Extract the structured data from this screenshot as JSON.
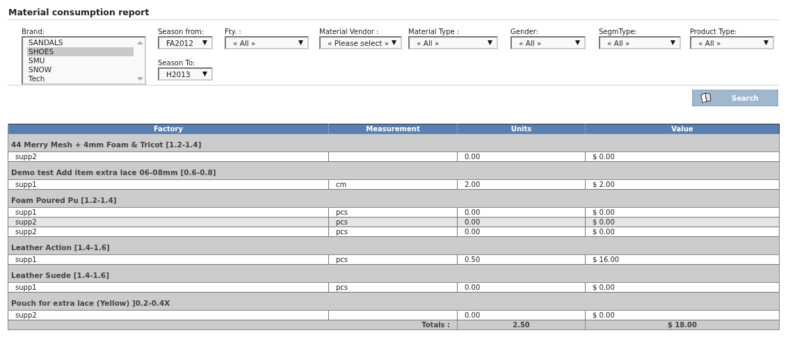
{
  "title": "Material consumption report",
  "filters": {
    "brand": {
      "label": "Brand:",
      "items": [
        {
          "label": "SANDALS",
          "selected": false
        },
        {
          "label": "SHOES",
          "selected": true
        },
        {
          "label": "SMU",
          "selected": false
        },
        {
          "label": "SNOW",
          "selected": false
        },
        {
          "label": "Tech",
          "selected": false
        }
      ]
    },
    "season_from": {
      "label": "Season from:",
      "value": "FA2012"
    },
    "season_to": {
      "label": "Season To:",
      "value": "H2013"
    },
    "selects": [
      {
        "label": "Fty. :",
        "value": "« All »"
      },
      {
        "label": "Material Vendor :",
        "value": "« Please select »"
      },
      {
        "label": "Material Type :",
        "value": "« All »"
      },
      {
        "label": "Gender:",
        "value": "« All »"
      },
      {
        "label": "SegmType:",
        "value": "« All »"
      },
      {
        "label": "Product Type:",
        "value": "« All »"
      }
    ]
  },
  "search_button": {
    "label": "Search",
    "disabled": true
  },
  "table": {
    "columns": [
      "Factory",
      "Measurement",
      "Units",
      "Value"
    ],
    "groups": [
      {
        "name": "44 Merry Mesh + 4mm Foam & Tricot [1.2-1.4]",
        "rows": [
          {
            "cells": [
              "supp2",
              "",
              "0.00",
              "$ 0.00"
            ],
            "highlighted": false
          }
        ]
      },
      {
        "name": "Demo test Add item extra lace 06-08mm [0.6-0.8]",
        "rows": [
          {
            "cells": [
              "supp1",
              "cm",
              "2.00",
              "$ 2.00"
            ],
            "highlighted": false
          }
        ]
      },
      {
        "name": "Foam Poured Pu [1.2-1.4]",
        "rows": [
          {
            "cells": [
              "supp1",
              "pcs",
              "0.00",
              "$ 0.00"
            ],
            "highlighted": false
          },
          {
            "cells": [
              "supp2",
              "pcs",
              "0.00",
              "$ 0.00"
            ],
            "highlighted": true
          },
          {
            "cells": [
              "supp2",
              "pcs",
              "0.00",
              "$ 0.00"
            ],
            "highlighted": false
          }
        ]
      },
      {
        "name": "Leather Action [1.4-1.6]",
        "rows": [
          {
            "cells": [
              "supp1",
              "pcs",
              "0.50",
              "$ 16.00"
            ],
            "highlighted": false
          }
        ]
      },
      {
        "name": "Leather Suede [1.4-1.6]",
        "rows": [
          {
            "cells": [
              "supp1",
              "pcs",
              "0.00",
              "$ 0.00"
            ],
            "highlighted": false
          }
        ]
      },
      {
        "name": "Pouch for extra lace (Yellow) ]0.2-0.4X",
        "rows": [
          {
            "cells": [
              "supp2",
              "",
              "0.00",
              "$ 0.00"
            ],
            "highlighted": false
          }
        ]
      }
    ],
    "totals": {
      "label": "Totals :",
      "units": "2.50",
      "value": "$ 18.00"
    }
  }
}
